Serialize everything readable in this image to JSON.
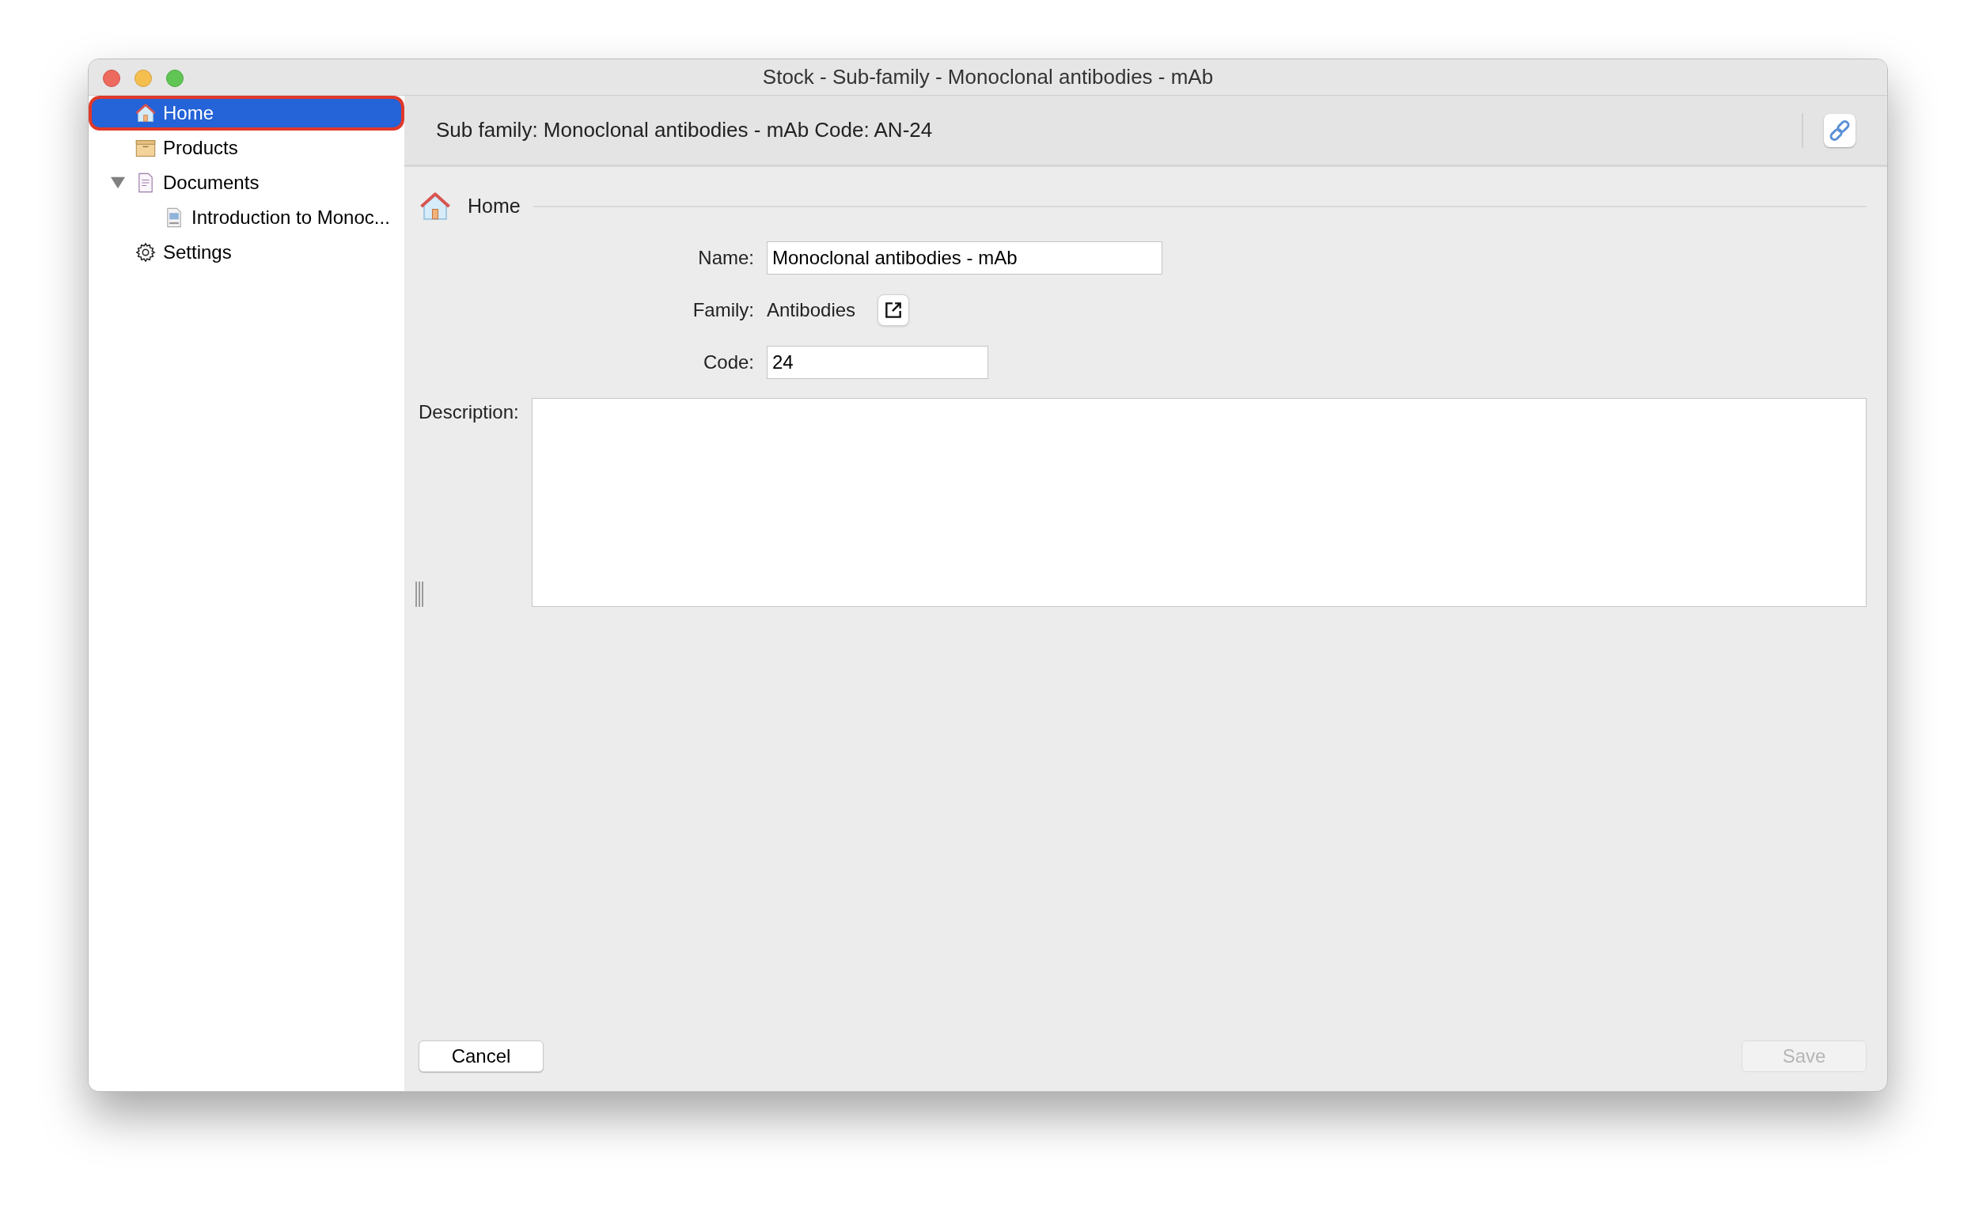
{
  "window": {
    "title": "Stock - Sub-family - Monoclonal antibodies - mAb"
  },
  "sidebar": {
    "items": [
      {
        "label": "Home",
        "kind": "home",
        "selected": true
      },
      {
        "label": "Products",
        "kind": "box",
        "selected": false
      },
      {
        "label": "Documents",
        "kind": "document",
        "selected": false,
        "expanded": true,
        "children": [
          {
            "label": "Introduction to Monoc...",
            "kind": "pdf",
            "selected": false
          }
        ]
      },
      {
        "label": "Settings",
        "kind": "gear",
        "selected": false
      }
    ]
  },
  "header": {
    "title": "Sub family: Monoclonal antibodies - mAb Code: AN-24"
  },
  "section": {
    "title": "Home"
  },
  "form": {
    "fields": [
      {
        "label": "Name:",
        "kind": "input",
        "value": "Monoclonal antibodies - mAb"
      },
      {
        "label": "Family:",
        "kind": "link",
        "value": "Antibodies"
      },
      {
        "label": "Code:",
        "kind": "short-input",
        "value": "24"
      },
      {
        "label": "Description:",
        "kind": "textarea"
      }
    ]
  },
  "buttons": [
    {
      "label": "Cancel",
      "disabled": false
    },
    {
      "label": "Save",
      "disabled": true
    }
  ]
}
